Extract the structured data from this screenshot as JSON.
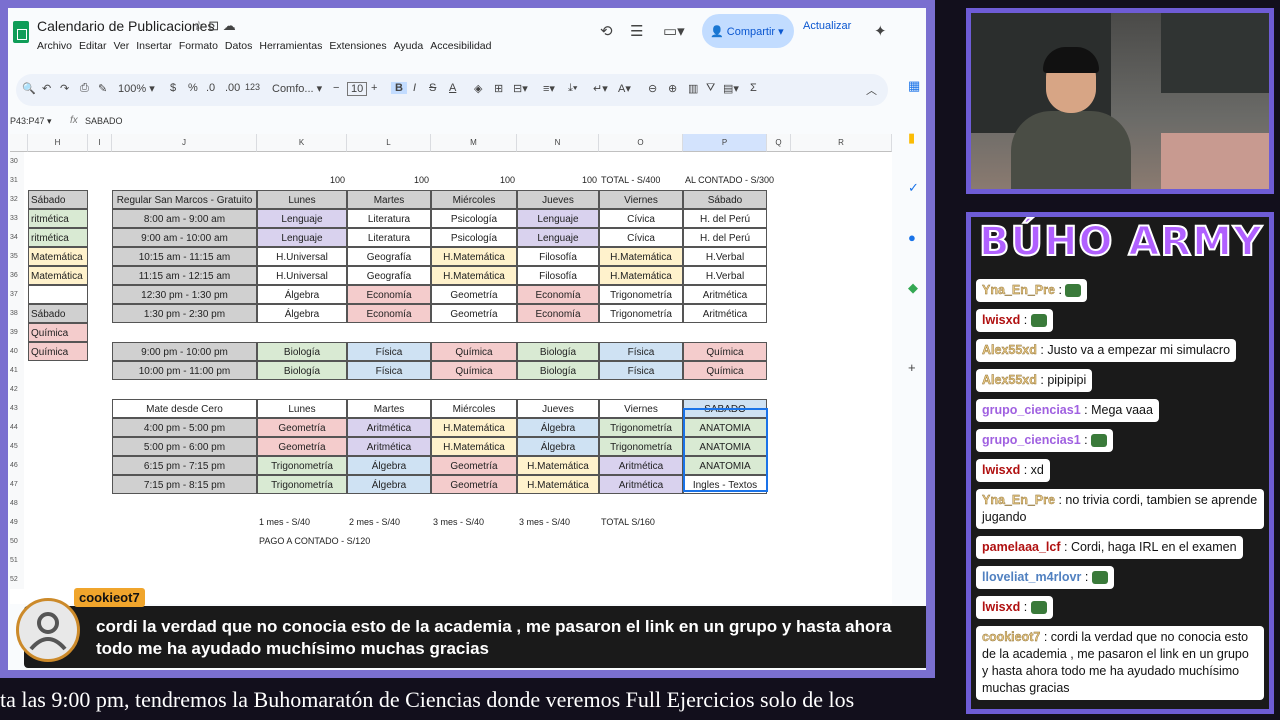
{
  "app": {
    "title": "Calendario de Publicaciones",
    "menus": [
      "Archivo",
      "Editar",
      "Ver",
      "Insertar",
      "Formato",
      "Datos",
      "Herramientas",
      "Extensiones",
      "Ayuda",
      "Accesibilidad"
    ],
    "share_label": "Compartir",
    "update_label": "Actualizar",
    "zoom": "100%",
    "font_name": "Comfo...",
    "font_size": "10",
    "currency": "$",
    "percent": "%",
    "dec_less": ".0",
    "dec_more": ".00",
    "num_fmt": "123",
    "name_box": "P43:P47",
    "formula": "SABADO"
  },
  "colors": {
    "accent": "#0b57d0",
    "frame": "#6e5cd6",
    "notif_user": "#f0a52c"
  },
  "columns": [
    "H",
    "I",
    "J",
    "K",
    "L",
    "M",
    "N",
    "O",
    "P",
    "Q",
    "R"
  ],
  "row_numbers": [
    "30",
    "31",
    "32",
    "33",
    "34",
    "35",
    "36",
    "37",
    "38",
    "39",
    "40",
    "41",
    "42",
    "43",
    "44",
    "45",
    "46",
    "47",
    "48",
    "49",
    "50",
    "51",
    "52"
  ],
  "row31": {
    "k": "100",
    "l": "100",
    "m": "100",
    "n": "100",
    "o": "TOTAL - S/400",
    "p": "AL CONTADO - S/300"
  },
  "h_col": [
    "Sábado",
    "ritmética",
    "ritmética",
    "Matemática",
    "Matemática",
    "",
    "Sábado",
    "Química",
    "Química"
  ],
  "block1": {
    "header": [
      "Regular San Marcos - Gratuito",
      "Lunes",
      "Martes",
      "Miércoles",
      "Jueves",
      "Viernes",
      "Sábado"
    ],
    "rows": [
      [
        "8:00 am - 9:00 am",
        "Lenguaje",
        "Literatura",
        "Psicología",
        "Lenguaje",
        "Cívica",
        "H. del Perú"
      ],
      [
        "9:00 am - 10:00 am",
        "Lenguaje",
        "Literatura",
        "Psicología",
        "Lenguaje",
        "Cívica",
        "H. del Perú"
      ],
      [
        "10:15 am - 11:15 am",
        "H.Universal",
        "Geografía",
        "H.Matemática",
        "Filosofía",
        "H.Matemática",
        "H.Verbal"
      ],
      [
        "11:15 am - 12:15 am",
        "H.Universal",
        "Geografía",
        "H.Matemática",
        "Filosofía",
        "H.Matemática",
        "H.Verbal"
      ],
      [
        "12:30 pm - 1:30 pm",
        "Álgebra",
        "Economía",
        "Geometría",
        "Economía",
        "Trigonometría",
        "Aritmética"
      ],
      [
        "1:30 pm - 2:30 pm",
        "Álgebra",
        "Economía",
        "Geometría",
        "Economía",
        "Trigonometría",
        "Aritmética"
      ]
    ]
  },
  "block2": {
    "rows": [
      [
        "9:00 pm - 10:00 pm",
        "Biología",
        "Física",
        "Química",
        "Biología",
        "Física",
        "Química"
      ],
      [
        "10:00 pm - 11:00 pm",
        "Biología",
        "Física",
        "Química",
        "Biología",
        "Física",
        "Química"
      ]
    ]
  },
  "block3": {
    "header": [
      "Mate desde Cero",
      "Lunes",
      "Martes",
      "Miércoles",
      "Jueves",
      "Viernes",
      "SABADO"
    ],
    "rows": [
      [
        "4:00 pm - 5:00 pm",
        "Geometría",
        "Aritmética",
        "H.Matemática",
        "Álgebra",
        "Trigonometría",
        "ANATOMIA"
      ],
      [
        "5:00 pm - 6:00 pm",
        "Geometría",
        "Aritmética",
        "H.Matemática",
        "Álgebra",
        "Trigonometría",
        "ANATOMIA"
      ],
      [
        "6:15 pm - 7:15 pm",
        "Trigonometría",
        "Álgebra",
        "Geometría",
        "H.Matemática",
        "Aritmética",
        "ANATOMIA"
      ],
      [
        "7:15 pm - 8:15 pm",
        "Trigonometría",
        "Álgebra",
        "Geometría",
        "H.Matemática",
        "Aritmética",
        "Ingles - Textos"
      ]
    ]
  },
  "row49": {
    "k": "1 mes - S/40",
    "l": "2 mes - S/40",
    "m": "3 mes - S/40",
    "n": "3 mes - S/40",
    "o": "TOTAL S/160"
  },
  "row50": {
    "k": "PAGO A CONTADO - S/120"
  },
  "notification": {
    "user": "cookieot7",
    "text": "cordi la verdad que no conocia esto de la academia , me pasaron el link en un grupo y hasta ahora todo me ha ayudado muchísimo muchas gracias"
  },
  "ticker": "ta las 9:00 pm, tendremos la Buhomaratón de Ciencias donde veremos Full Ejercicios solo de los",
  "chat": {
    "title": "BÚHO ARMY",
    "messages": [
      {
        "user": "Yna_En_Pre",
        "text": "",
        "style": ""
      },
      {
        "user": "lwisxd",
        "text": "",
        "style": "red"
      },
      {
        "user": "Alex55xd",
        "text": "Justo va a empezar mi simulacro",
        "style": ""
      },
      {
        "user": "Alex55xd",
        "text": "pipipipi",
        "style": ""
      },
      {
        "user": "grupo_ciencias1",
        "text": "Mega vaaa",
        "style": "violet"
      },
      {
        "user": "grupo_ciencias1",
        "text": "",
        "style": "violet"
      },
      {
        "user": "lwisxd",
        "text": "xd",
        "style": "red"
      },
      {
        "user": "Yna_En_Pre",
        "text": "no trivia cordi, tambien se aprende jugando",
        "style": ""
      },
      {
        "user": "pamelaaa_lcf",
        "text": "Cordi, haga IRL en el examen",
        "style": "red"
      },
      {
        "user": "lloveliat_m4rlovr",
        "text": "",
        "style": "blue"
      },
      {
        "user": "lwisxd",
        "text": "",
        "style": "red"
      },
      {
        "user": "cookieot7",
        "text": "cordi la verdad que no conocia esto de la academia , me pasaron el link en un grupo y hasta ahora todo me ha ayudado muchísimo muchas gracias",
        "style": ""
      }
    ]
  }
}
